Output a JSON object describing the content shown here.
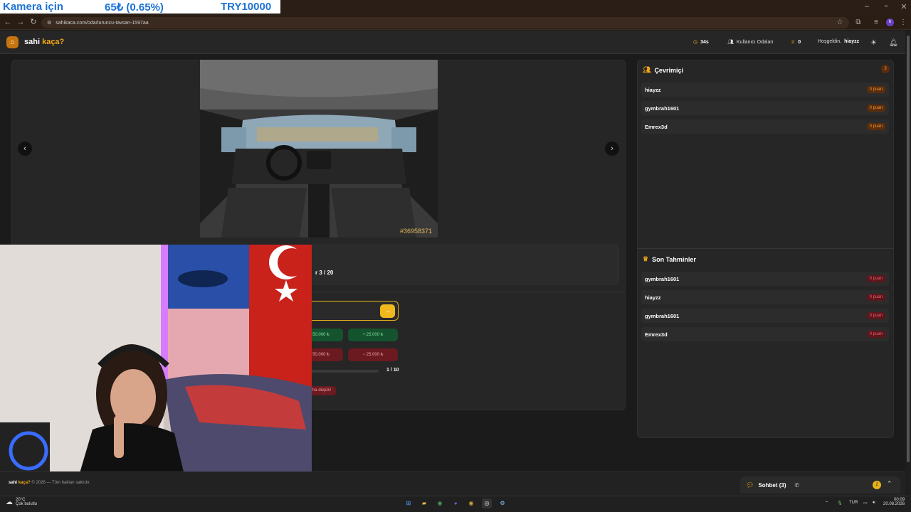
{
  "stream_overlay": {
    "left": "Kamera için",
    "middle": "65₺ (0.65%)",
    "right": "TRY10000"
  },
  "browser": {
    "url": "sahikaca.com/oda/turuncu-tavsan-1597aa",
    "profile_initial": "h"
  },
  "site": {
    "logo_part1": "sahi",
    "logo_part2": "kaça?",
    "timer": "34s",
    "rooms_label": "Kullanıcı Odaları",
    "score": "0",
    "welcome_prefix": "Hoşgeldin,",
    "username": "hiayzz"
  },
  "game": {
    "image_id": "#36958371",
    "progress_prefix": "r 3 / 20",
    "chips_up": [
      "50.000 ₺",
      "+ 25.000 ₺"
    ],
    "chips_down": [
      "50.000 ₺",
      "− 25.000 ₺"
    ],
    "guess_counter": "1 / 10",
    "hint_text": "ha düşük!"
  },
  "online": {
    "title": "Çevrimiçi",
    "count": "3",
    "users": [
      {
        "name": "hiayzz",
        "points": "0 puan"
      },
      {
        "name": "gymbrah1601",
        "points": "0 puan"
      },
      {
        "name": "Emrex3d",
        "points": "0 puan"
      }
    ]
  },
  "recent": {
    "title": "Son Tahminler",
    "entries": [
      {
        "name": "gymbrah1601",
        "points": "0 puan"
      },
      {
        "name": "hiayzz",
        "points": "0 puan"
      },
      {
        "name": "gymbrah1601",
        "points": "0 puan"
      },
      {
        "name": "Emrex3d",
        "points": "0 puan"
      }
    ]
  },
  "footer": {
    "brand1": "sahi",
    "brand2": "kaça?",
    "copyright": "© 2026 — Tüm hakları saklıdır."
  },
  "chat": {
    "label": "Sohbet (3)",
    "badge": "2"
  },
  "taskbar": {
    "temp": "20°C",
    "weather": "Çok bulutlu",
    "lang": "TUR",
    "time": "00:09",
    "date": "20.08.2026"
  },
  "colors": {
    "accent": "#f2a818",
    "positive": "#14532d",
    "negative": "#6b1a1f"
  }
}
